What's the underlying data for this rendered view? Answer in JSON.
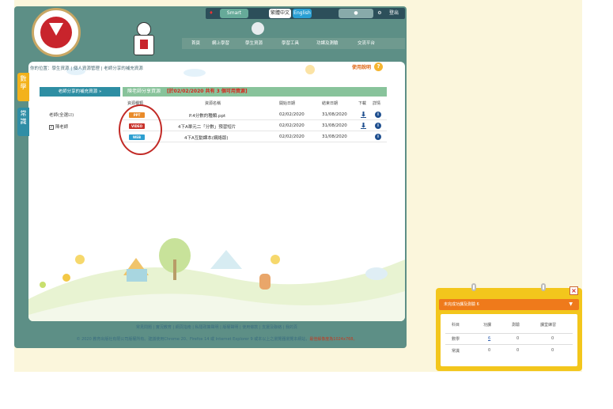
{
  "topbar": {
    "smart_label": "Smart",
    "lang_trad": "繁體中文",
    "lang_en": "English",
    "logout": "登出"
  },
  "logo": {
    "text": "Emmanuel Primary School"
  },
  "nav": {
    "items": [
      "首頁",
      "網上學習",
      "學生資源",
      "學習工具",
      "功課及測驗",
      "交流平台"
    ]
  },
  "breadcrumb": "你的位置：學生資源 | 個人資源管理 | 老師分享的補充資源",
  "help": {
    "label": "使用說明",
    "icon": "question-icon"
  },
  "sidetabs": [
    {
      "label": "數學",
      "color": "#f3b21b"
    },
    {
      "label": "常識",
      "color": "#2f8ea6"
    }
  ],
  "left_menu": {
    "title": "老師分享的補充資源",
    "options": [
      {
        "label": "老師(全選☑)",
        "checked": false
      },
      {
        "label": "陳老師",
        "checked": true
      }
    ]
  },
  "panel": {
    "title": "陳老師分享資源",
    "count_text": "[於02/02/2020 共有 3 個可用資源]"
  },
  "table": {
    "headers": [
      "資源種類",
      "資源名稱",
      "開始日期",
      "結束日期",
      "下載",
      "詳情"
    ],
    "rows": [
      {
        "type": "PPT",
        "type_color": "#e98b2a",
        "name": "P.4分數的種類.ppt",
        "start": "02/02/2020",
        "end": "31/08/2020",
        "download": true
      },
      {
        "type": "VIDEO",
        "type_color": "#c8322b",
        "name": "4下A單元二「分數」預習短片",
        "start": "02/02/2020",
        "end": "31/08/2020",
        "download": true
      },
      {
        "type": "WEB",
        "type_color": "#2e9fd0",
        "name": "4下A互動課本(網絡版)",
        "start": "02/02/2020",
        "end": "31/08/2020",
        "download": false
      }
    ]
  },
  "footer": {
    "links": "常見問題 | 實況教育 | 網頁指南 | 私隱政策聲明 | 版權聲明 | 使用條款 | 支援及聯絡 | 我的頁",
    "copy": "© 2020 教育出版社有限公司版權所有。建議使用Chrome 20、Firefox 14 或 Internet Explorer 9 或本以上之瀏覽器瀏覽本網站，",
    "copy_warn": "最佳解像度為1024x768。"
  },
  "widget": {
    "title": "未完成功課及測驗 6",
    "headers": [
      "科目",
      "功課",
      "測驗",
      "課堂練習"
    ],
    "rows": [
      {
        "subject": "數學",
        "homework": "6",
        "test": "0",
        "practice": "0"
      },
      {
        "subject": "常識",
        "homework": "0",
        "test": "0",
        "practice": "0"
      }
    ]
  }
}
